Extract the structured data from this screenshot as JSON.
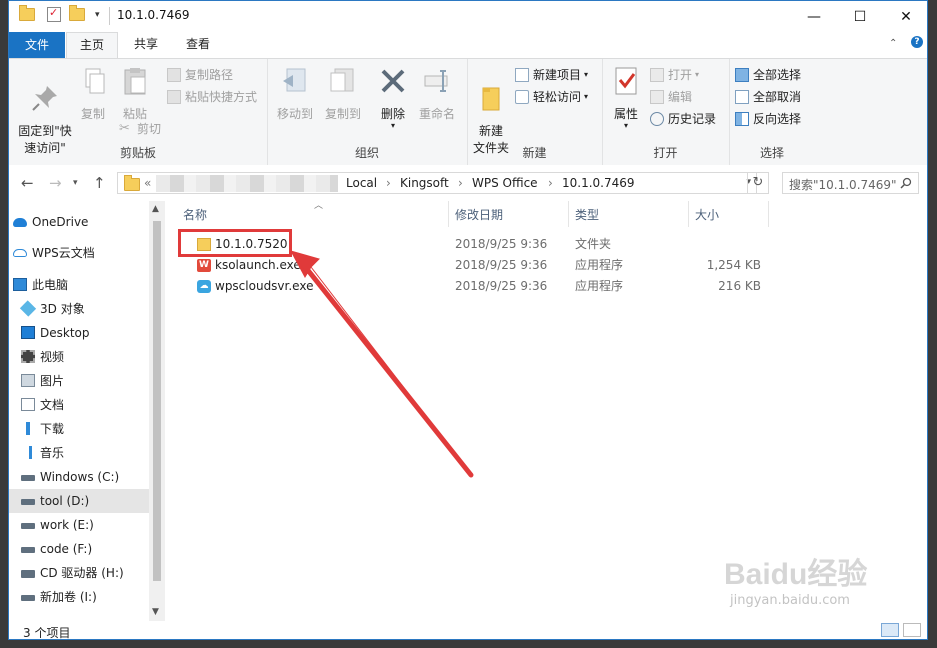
{
  "window": {
    "title": "10.1.0.7469",
    "controls": {
      "minimize": "—",
      "maximize": "☐",
      "close": "✕"
    }
  },
  "tabs": [
    {
      "label": "文件"
    },
    {
      "label": "主页"
    },
    {
      "label": "共享"
    },
    {
      "label": "查看"
    }
  ],
  "ribbon": {
    "clipboard": {
      "group_label": "剪贴板",
      "pin_label": "固定到\"快\n速访问\"",
      "copy_label": "复制",
      "paste_label": "粘贴",
      "copy_path_label": "复制路径",
      "paste_shortcut_label": "粘贴快捷方式",
      "cut_label": "剪切"
    },
    "organize": {
      "group_label": "组织",
      "move_to_label": "移动到",
      "copy_to_label": "复制到",
      "delete_label": "删除",
      "rename_label": "重命名"
    },
    "new": {
      "group_label": "新建",
      "new_folder_label": "新建\n文件夹",
      "new_item_label": "新建项目",
      "easy_access_label": "轻松访问"
    },
    "open": {
      "group_label": "打开",
      "properties_label": "属性",
      "open_label": "打开",
      "edit_label": "编辑",
      "history_label": "历史记录"
    },
    "select": {
      "group_label": "选择",
      "select_all_label": "全部选择",
      "select_none_label": "全部取消",
      "invert_label": "反向选择"
    }
  },
  "address": {
    "crumbs": [
      "Local",
      "Kingsoft",
      "WPS Office",
      "10.1.0.7469"
    ],
    "separator": "›",
    "search_placeholder": "搜索\"10.1.0.7469\""
  },
  "nav": {
    "items": [
      {
        "label": "OneDrive",
        "icon": "cloud-icon"
      },
      {
        "label": "WPS云文档",
        "icon": "cloud-outline-icon"
      },
      {
        "label": "此电脑",
        "icon": "computer-icon"
      },
      {
        "label": "3D 对象",
        "icon": "cube-icon"
      },
      {
        "label": "Desktop",
        "icon": "desktop-icon"
      },
      {
        "label": "视频",
        "icon": "video-icon"
      },
      {
        "label": "图片",
        "icon": "picture-icon"
      },
      {
        "label": "文档",
        "icon": "document-icon"
      },
      {
        "label": "下载",
        "icon": "download-icon"
      },
      {
        "label": "音乐",
        "icon": "music-icon"
      },
      {
        "label": "Windows (C:)",
        "icon": "drive-icon"
      },
      {
        "label": "tool (D:)",
        "icon": "drive-icon"
      },
      {
        "label": "work (E:)",
        "icon": "drive-icon"
      },
      {
        "label": "code (F:)",
        "icon": "drive-icon"
      },
      {
        "label": "CD 驱动器 (H:)",
        "icon": "cd-icon"
      },
      {
        "label": "新加卷 (I:)",
        "icon": "drive-icon"
      }
    ],
    "selected": "tool (D:)"
  },
  "columns": {
    "name": "名称",
    "date": "修改日期",
    "type": "类型",
    "size": "大小"
  },
  "files": [
    {
      "name": "10.1.0.7520",
      "date": "2018/9/25 9:36",
      "type": "文件夹",
      "size": "",
      "icon": "folder-icon"
    },
    {
      "name": "ksolaunch.exe",
      "date": "2018/9/25 9:36",
      "type": "应用程序",
      "size": "1,254 KB",
      "icon": "wps-app-icon"
    },
    {
      "name": "wpscloudsvr.exe",
      "date": "2018/9/25 9:36",
      "type": "应用程序",
      "size": "216 KB",
      "icon": "wps-cloud-icon"
    }
  ],
  "status": {
    "count": "3 个项目"
  },
  "watermark": {
    "brand": "Baidu经验",
    "url": "jingyan.baidu.com"
  },
  "colors": {
    "accent": "#1a73c4",
    "annotation": "#e03a3a",
    "folder": "#f6ce5b"
  }
}
